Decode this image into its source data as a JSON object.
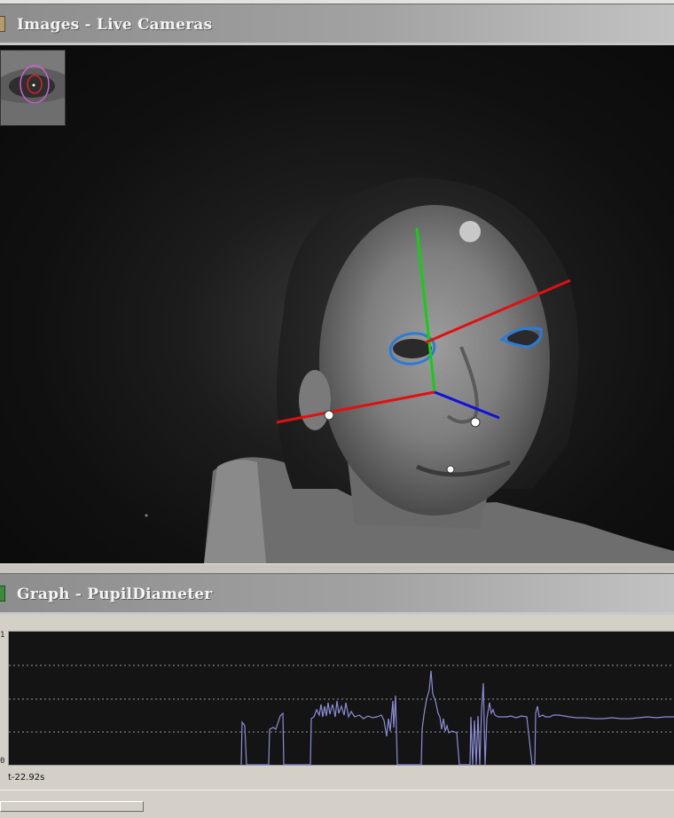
{
  "windows": {
    "cameras": {
      "title": "Images - Live Cameras"
    },
    "graph": {
      "title": "Graph - PupilDiameter"
    }
  },
  "graph": {
    "y_top_label": "1",
    "y_bottom_label": "0",
    "time_label": "t-22.92s"
  },
  "colors": {
    "axis_x": "#e01010",
    "axis_y": "#10d010",
    "axis_z": "#1010e0",
    "eye_outline": "#2b7bd8",
    "trace": "#8c8cd6"
  },
  "icons": [
    "camera-window-icon",
    "graph-window-icon"
  ]
}
